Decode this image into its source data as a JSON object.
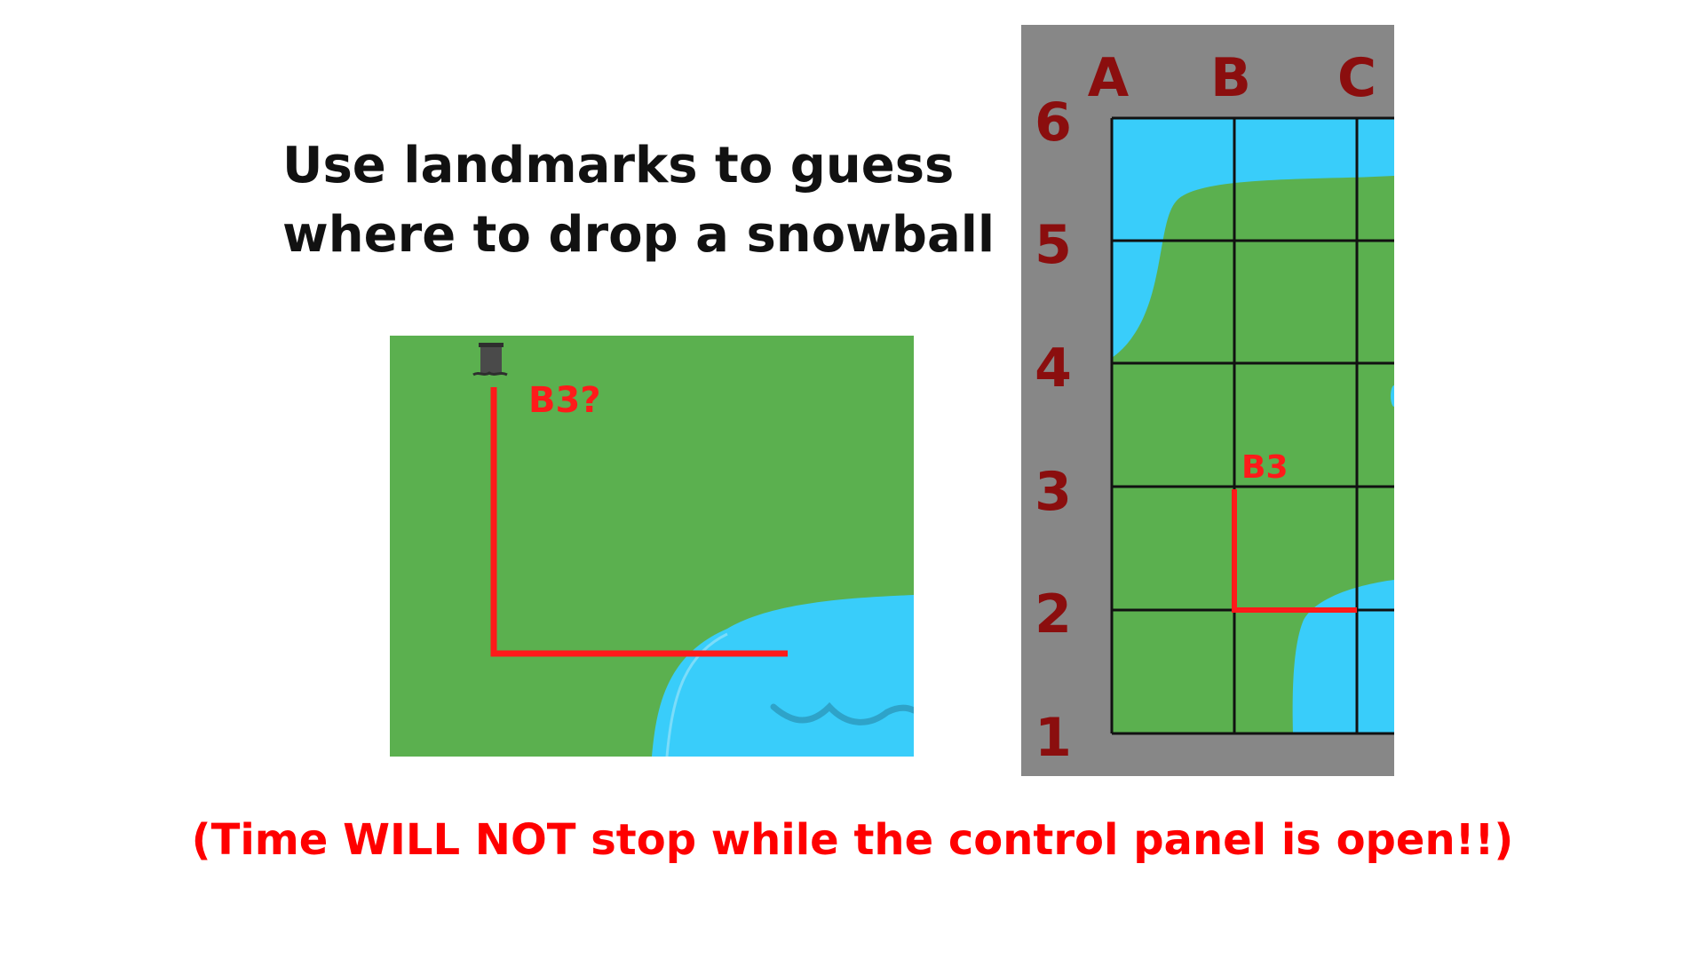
{
  "headline": {
    "line1": "Use landmarks to guess",
    "line2": "where to drop a snowball"
  },
  "scene": {
    "guess_label": "B3?"
  },
  "grid": {
    "columns": [
      "A",
      "B",
      "C"
    ],
    "rows": [
      "6",
      "5",
      "4",
      "3",
      "2",
      "1"
    ],
    "marker_label": "B3"
  },
  "footer": {
    "open_paren": "(Time ",
    "emphasis": "WILL NOT",
    "rest": " stop while the control panel is open!!)"
  },
  "colors": {
    "grass": "#5bb04f",
    "water": "#39cdfa",
    "marker": "#ff0000",
    "label": "#8b0e0e",
    "frame": "#878787"
  }
}
